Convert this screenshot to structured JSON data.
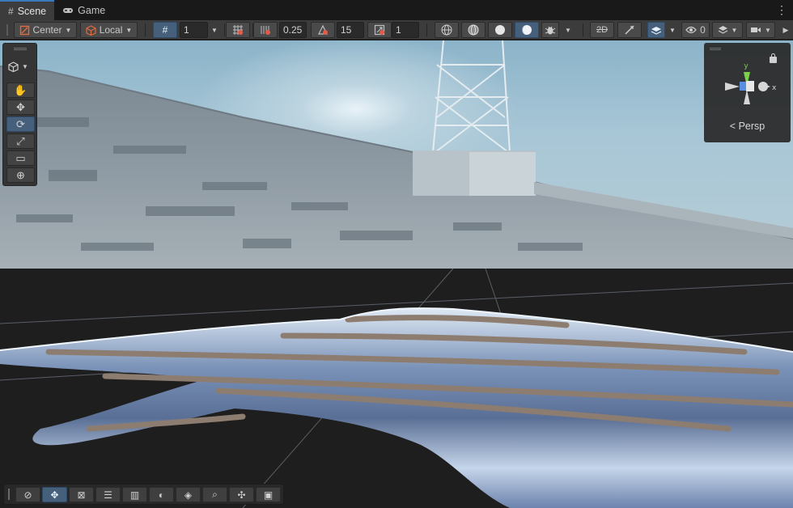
{
  "tabs": [
    {
      "label": "Scene",
      "icon": "grid-icon",
      "active": true
    },
    {
      "label": "Game",
      "icon": "gamepad-icon",
      "active": false
    }
  ],
  "toolbar": {
    "pivot_mode": "Center",
    "pivot_rotation": "Local",
    "grid_size": "1",
    "snap_increment": "0.25",
    "rotation_snap": "15",
    "scale_snap": "1",
    "visible_count": "0"
  },
  "gizmo": {
    "projection_label": "Persp",
    "axis_colors": {
      "y": "#7bd24a",
      "x": "#e15b4e",
      "z": "#5a8ee0"
    }
  },
  "colors": {
    "accent": "#46607c",
    "tab_highlight": "#3a79bb",
    "sky": "#a7c6d6",
    "floor": "#8f98a5"
  },
  "scene_tools": [
    "hand-tool-icon",
    "move-tool-icon",
    "rotate-tool-icon",
    "scale-tool-icon",
    "rect-tool-icon",
    "transform-tool-icon"
  ],
  "active_tool": "rotate-tool-icon",
  "overlay_tools": [
    "compass-icon",
    "move-icon",
    "terrain-icon",
    "sliders-icon",
    "grid-lines-icon",
    "moon-icon",
    "navmesh-icon",
    "search-icon",
    "pivot-icon",
    "camera-icon"
  ]
}
